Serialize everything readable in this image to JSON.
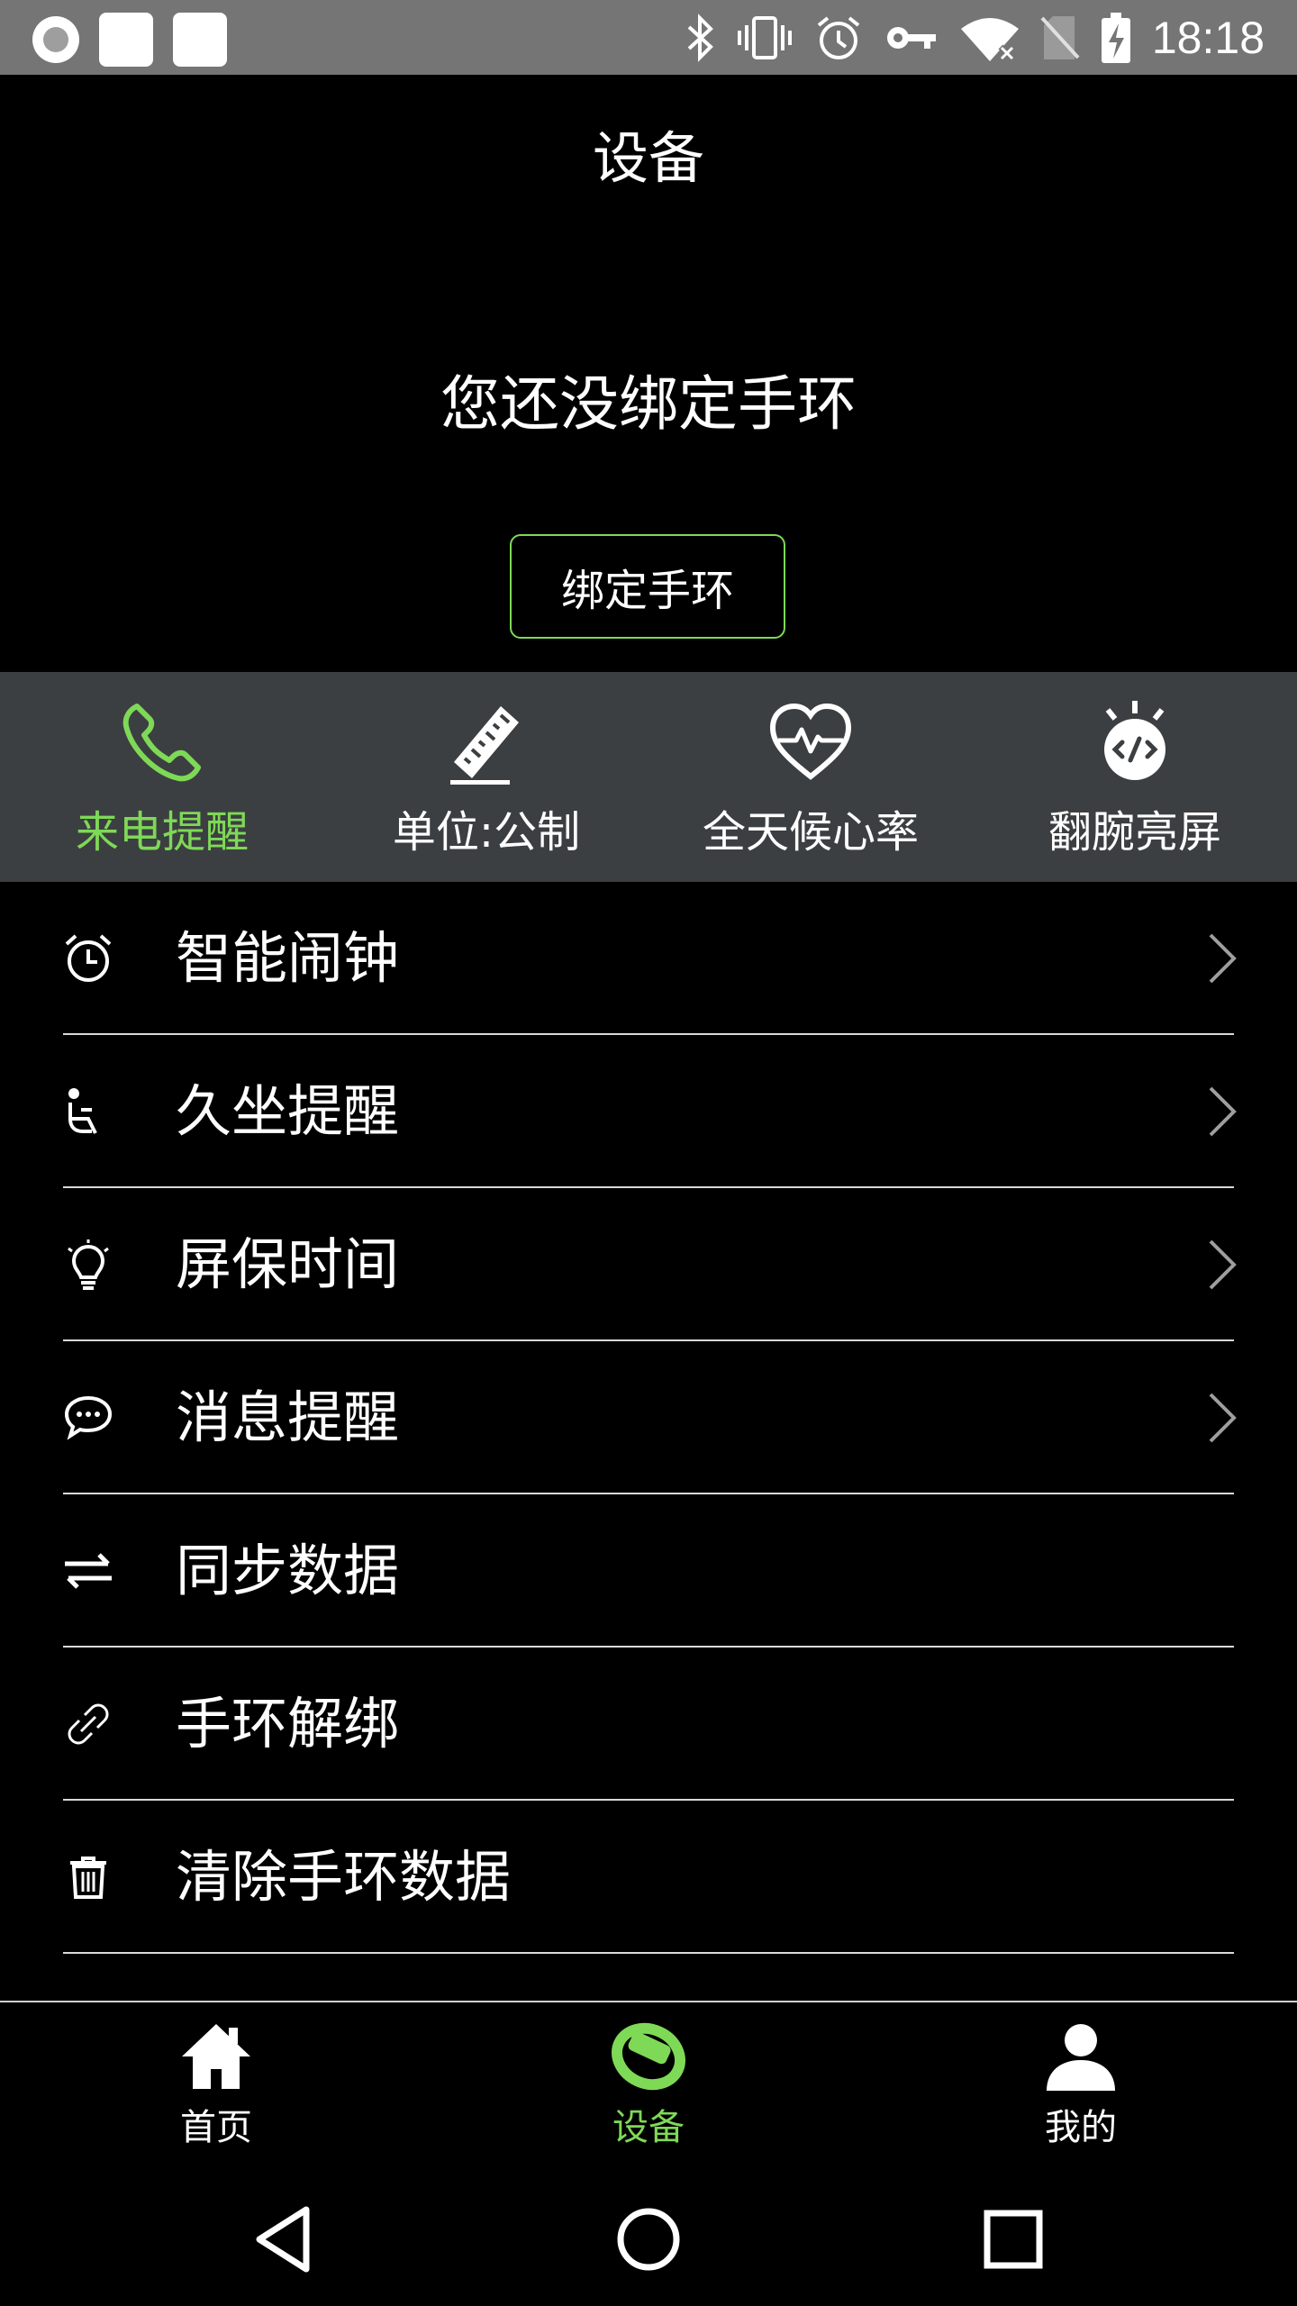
{
  "status_bar": {
    "time": "18:18",
    "icons": [
      "record-icon",
      "notification-square-icon",
      "notification-square-icon",
      "bluetooth-icon",
      "vibrate-icon",
      "alarm-icon",
      "vpn-key-icon",
      "wifi-icon",
      "no-sim-icon",
      "battery-charging-icon"
    ]
  },
  "header": {
    "title": "设备",
    "bind_message": "您还没绑定手环",
    "bind_button": "绑定手环"
  },
  "quick_settings": [
    {
      "label": "来电提醒",
      "icon": "phone-icon",
      "active": true
    },
    {
      "label": "单位:公制",
      "icon": "ruler-icon",
      "active": false
    },
    {
      "label": "全天候心率",
      "icon": "heart-rate-icon",
      "active": false
    },
    {
      "label": "翻腕亮屏",
      "icon": "wrist-screen-icon",
      "active": false
    }
  ],
  "settings": [
    {
      "label": "智能闹钟",
      "icon": "alarm-clock-icon",
      "chevron": true
    },
    {
      "label": "久坐提醒",
      "icon": "seat-icon",
      "chevron": true
    },
    {
      "label": "屏保时间",
      "icon": "lightbulb-icon",
      "chevron": true
    },
    {
      "label": "消息提醒",
      "icon": "message-icon",
      "chevron": true
    },
    {
      "label": "同步数据",
      "icon": "sync-arrows-icon",
      "chevron": false
    },
    {
      "label": "手环解绑",
      "icon": "unlink-icon",
      "chevron": false
    },
    {
      "label": "清除手环数据",
      "icon": "trash-icon",
      "chevron": false
    }
  ],
  "bottom_nav": [
    {
      "label": "首页",
      "icon": "home-icon",
      "active": false
    },
    {
      "label": "设备",
      "icon": "band-icon",
      "active": true
    },
    {
      "label": "我的",
      "icon": "person-icon",
      "active": false
    }
  ],
  "colors": {
    "accent": "#7ed957",
    "strip_bg": "#3c3f41",
    "status_bar_bg": "#757575",
    "background": "#000000"
  }
}
